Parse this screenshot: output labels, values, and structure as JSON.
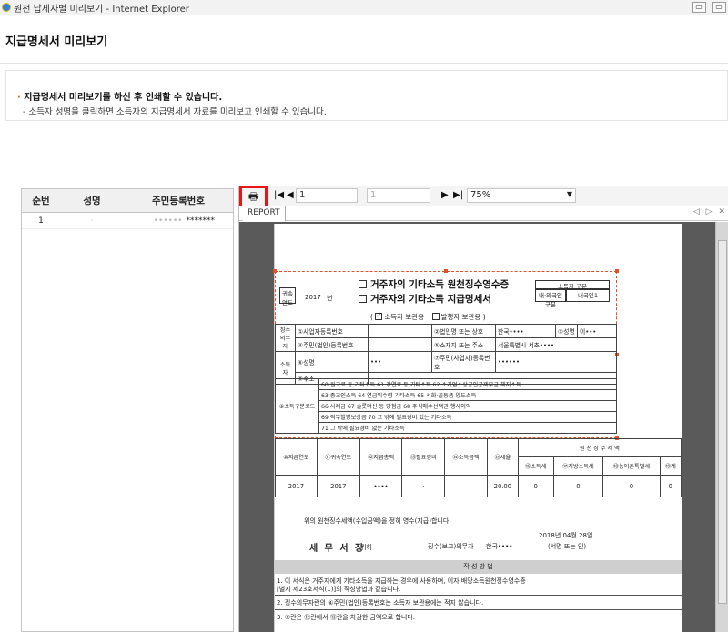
{
  "window": {
    "title": "원천 납세자별 미리보기 - Internet Explorer",
    "controls": [
      "▭",
      "▭"
    ]
  },
  "page": {
    "title": "지급명세서 미리보기"
  },
  "notice": {
    "line1_bullet": "·",
    "line1": "지급명세서 미리보기를 하신 후 인쇄할 수 있습니다.",
    "line2": "- 소득자 성명을 클릭하면 소득자의 지급명세서 자료를 미리보고 인쇄할 수 있습니다."
  },
  "list": {
    "headers": [
      "순번",
      "성명",
      "주민등록번호"
    ],
    "rows": [
      {
        "no": "1",
        "name": "·",
        "id_prefix": "••••••",
        "id_mask": "*******"
      }
    ]
  },
  "viewer": {
    "print_icon": "🖶",
    "first": "◀",
    "prev": "◀",
    "next": "▶",
    "last": "▶",
    "current_page": "1",
    "total_pages": "1",
    "zoom": "75%",
    "tab": "REPORT",
    "tab_controls": "◁ ▷ ✕"
  },
  "form": {
    "title1": "거주자의 기타소득 원천징수영수증",
    "title2": "거주자의 기타소득 지급명세서",
    "year_label": "귀속연도",
    "year": "2017",
    "year_suffix": "년",
    "type_label": "소득자 구분",
    "type_sub1": "내·외국인 구분",
    "type_sub2": "내국인1",
    "copy_options": [
      "소득자 보관용",
      "발행자 보관용"
    ],
    "copy_open": "(",
    "copy_close": ")",
    "payer": {
      "side_label": "징수의무자",
      "r1a": "①사업자등록번호",
      "r1b": "",
      "r1c": "②법인명 또는 상호",
      "r1d": "한국••••",
      "r1e": "③성명",
      "r1f": "이•••",
      "r2a": "④주민(법인)등록번호",
      "r2b": "",
      "r2c": "⑤소재지 또는 주소",
      "r2d": "서울특별시 서초••••"
    },
    "earner": {
      "side_label": "소득자",
      "r1a": "⑥성명",
      "r1b": "•••",
      "r1c": "⑦주민(사업자)등록번호",
      "r1d": "••••••",
      "r2a": "⑧주소",
      "r2b": ""
    },
    "income_kind_label": "⑨소득구분코드",
    "income_kind_rows": [
      "60 원고료 등 기타소득  61 강연료 등 기타소득  62 소기업소상공인공제부금 해지소득",
      "63 종교인소득  64 연금외수령 기타소득  65 서화·골동품 양도소득",
      "66 사례금  67 슬롯머신 등 당첨금  68 주식매수선택권 행사이익",
      "69 직무발명보상금  70 그 밖에 필요경비 있는 기타소득",
      "71 그 밖에 필요경비 없는 기타소득"
    ],
    "withholding_label": "원 천 징 수 세 액",
    "columns": [
      "⑩지급연도",
      "⑪귀속연도",
      "⑫지급총액",
      "⑬필요경비",
      "⑭소득금액",
      "⑮세율",
      "⑯소득세",
      "⑰지방소득세",
      "⑱농어촌특별세",
      "⑲계"
    ],
    "row": [
      "2017",
      "2017",
      "••••",
      "·",
      "",
      "20.00",
      "0",
      "0",
      "0",
      "0"
    ],
    "statement": "위의 원천징수세액(수입금액)을 정히 영수(지급)합니다.",
    "date": "2018년 04월 28일",
    "signer_label": "징수(보고)의무자",
    "signer_name": "한국••••",
    "signer_seal": "(서명 또는 인)",
    "office": "세 무 서 장",
    "office_suffix": "귀하",
    "guide_title": "작 성 방 법",
    "guide": [
      "1. 이 서식은 거주자에게 기타소득을 지급하는 경우에 사용하며, 이자·배당소득원천징수영수증",
      "   [별지 제23호서식(1)]의 작성방법과 같습니다.",
      "2. 징수의무자란의 ④주민(법인)등록번호는 소득자 보관용에는 적지 않습니다.",
      "3. ⑨란은 ⑫란에서 ⑬란을 차감한 금액으로 합니다."
    ]
  },
  "icons": [
    "ie-icon",
    "printer-icon",
    "first-page-icon",
    "prev-page-icon",
    "next-page-icon",
    "last-page-icon",
    "chevron-down-icon"
  ],
  "colors": {
    "highlight": "#e81717",
    "selection": "#e2502a",
    "doc_bg": "#5a5a5a"
  }
}
